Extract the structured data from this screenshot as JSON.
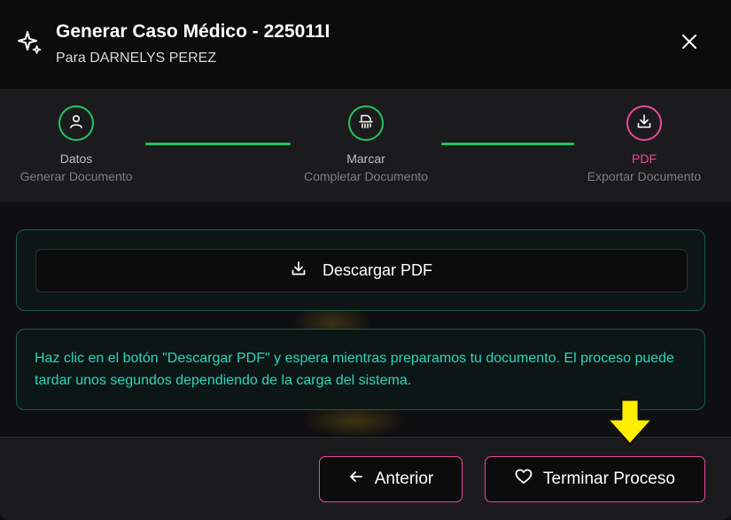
{
  "header": {
    "title": "Generar Caso Médico - 225011I",
    "subtitle": "Para DARNELYS PEREZ",
    "icon": "sparkles-icon",
    "close_icon": "close-icon"
  },
  "steps": [
    {
      "label": "Datos",
      "sub": "Generar Documento",
      "icon": "user-icon",
      "status": "complete",
      "color": "#22c55e"
    },
    {
      "label": "Marcar",
      "sub": "Completar Documento",
      "icon": "document-scan-icon",
      "status": "complete",
      "color": "#22c55e"
    },
    {
      "label": "PDF",
      "sub": "Exportar Documento",
      "icon": "download-icon",
      "status": "active",
      "color": "#ec4899"
    }
  ],
  "download": {
    "label": "Descargar PDF",
    "icon": "download-icon"
  },
  "info": {
    "text": "Haz clic en el botón \"Descargar PDF\" y espera mientras preparamos tu documento. El proceso puede tardar unos segundos dependiendo de la carga del sistema."
  },
  "footer": {
    "prev_label": "Anterior",
    "prev_icon": "arrow-left-icon",
    "finish_label": "Terminar Proceso",
    "finish_icon": "heart-icon"
  },
  "colors": {
    "accent_green": "#22c55e",
    "accent_pink": "#ec4899",
    "info_text": "#2dd4bf",
    "annotation_arrow": "#ffee00"
  }
}
